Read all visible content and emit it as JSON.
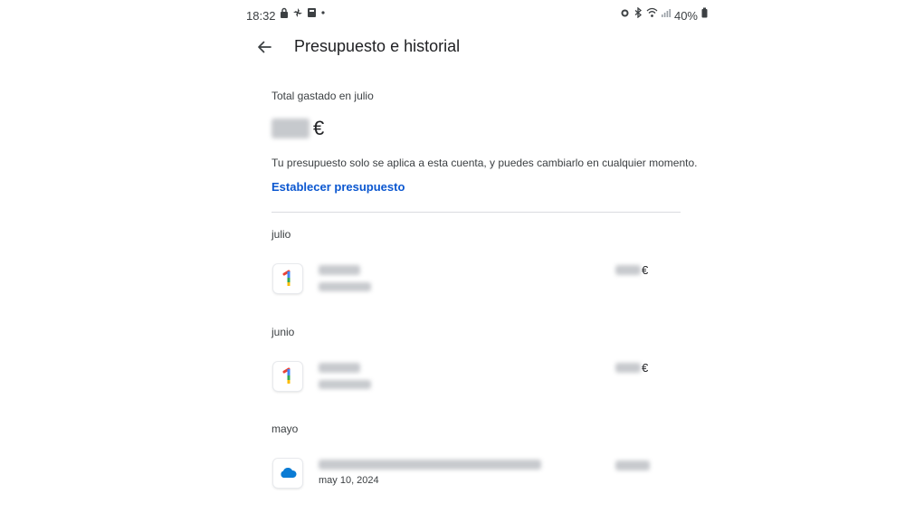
{
  "status_bar": {
    "time": "18:32",
    "left_icons": [
      "lock-icon",
      "pinwheel-icon",
      "card-icon",
      "dot-icon"
    ],
    "battery": "40%",
    "right_icons": [
      "alarm-icon",
      "bluetooth-icon",
      "wifi-icon",
      "signal-icon"
    ]
  },
  "header": {
    "title": "Presupuesto e historial"
  },
  "summary": {
    "label": "Total gastado en julio",
    "currency": "€",
    "note": "Tu presupuesto solo se aplica a esta cuenta, y puedes cambiarlo en cualquier momento.",
    "action_label": "Establecer presupuesto"
  },
  "history": [
    {
      "month": "julio",
      "transactions": [
        {
          "icon": "google-one-icon",
          "date": "",
          "currency": "€"
        }
      ]
    },
    {
      "month": "junio",
      "transactions": [
        {
          "icon": "google-one-icon",
          "date": "",
          "currency": "€"
        }
      ]
    },
    {
      "month": "mayo",
      "transactions": [
        {
          "icon": "onedrive-cloud-icon",
          "date": "may 10, 2024",
          "currency": ""
        }
      ]
    }
  ],
  "colors": {
    "link": "#0b57d0",
    "text": "#202124",
    "secondary": "#3c4043",
    "divider": "#dadce0"
  }
}
